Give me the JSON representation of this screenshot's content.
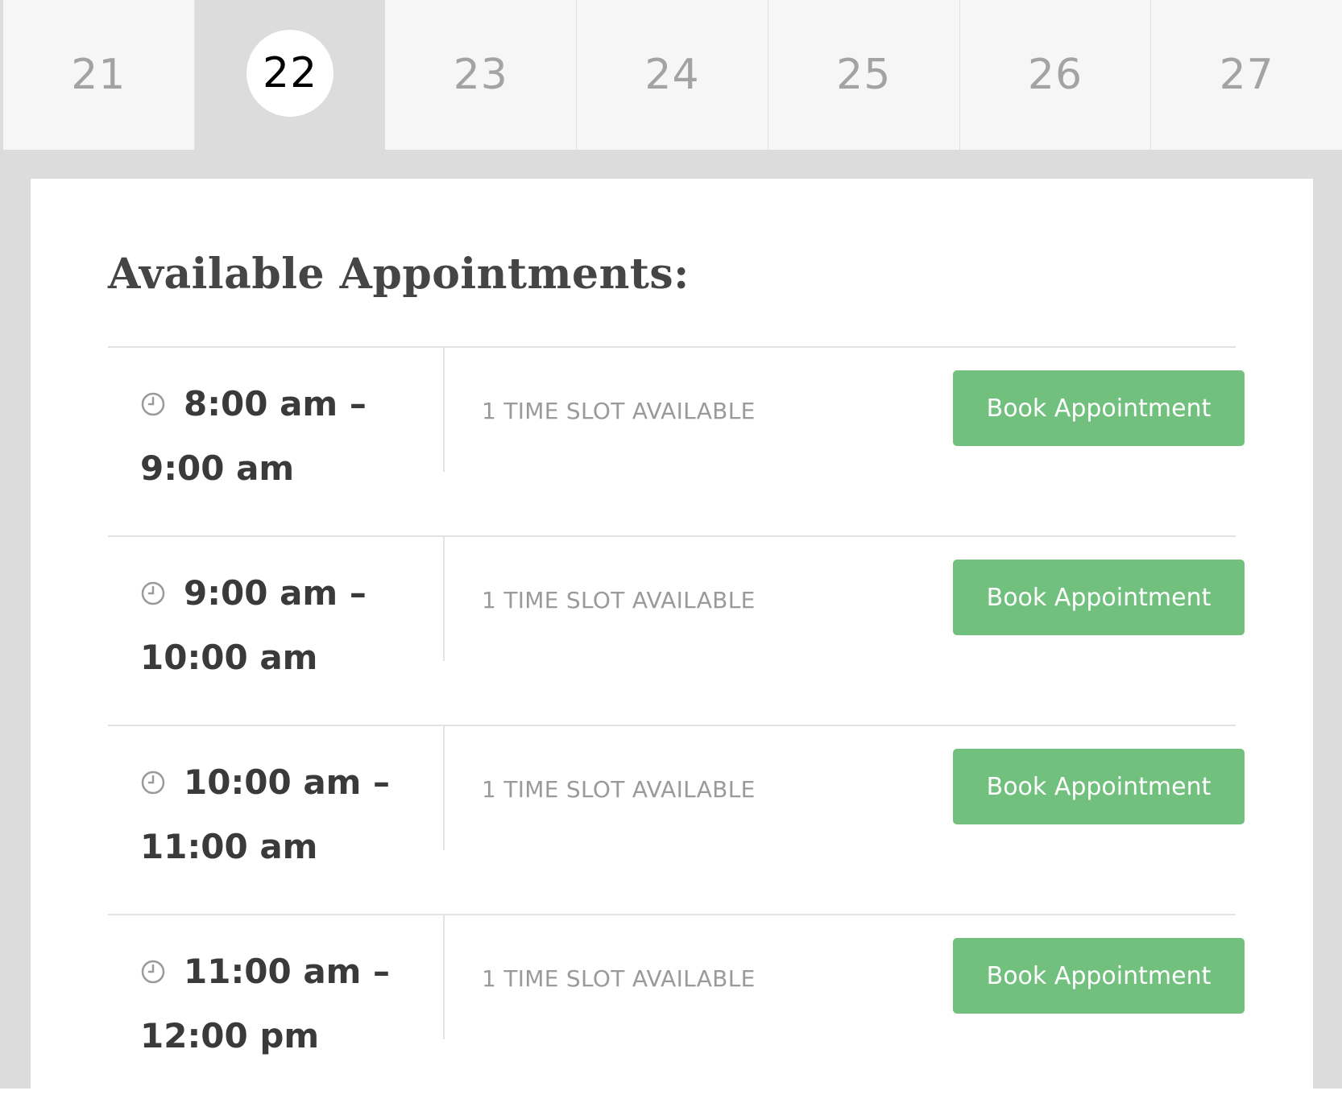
{
  "calendar": {
    "days": [
      {
        "label": "21",
        "selected": false
      },
      {
        "label": "22",
        "selected": true
      },
      {
        "label": "23",
        "selected": false
      },
      {
        "label": "24",
        "selected": false
      },
      {
        "label": "25",
        "selected": false
      },
      {
        "label": "26",
        "selected": false
      },
      {
        "label": "27",
        "selected": false
      }
    ]
  },
  "panel": {
    "title": "Available Appointments:"
  },
  "slots": [
    {
      "time": "8:00 am – 9:00 am",
      "availability": "1 TIME SLOT AVAILABLE",
      "button_label": "Book Appointment"
    },
    {
      "time": "9:00 am – 10:00 am",
      "availability": "1 TIME SLOT AVAILABLE",
      "button_label": "Book Appointment"
    },
    {
      "time": "10:00 am – 11:00 am",
      "availability": "1 TIME SLOT AVAILABLE",
      "button_label": "Book Appointment"
    },
    {
      "time": "11:00 am – 12:00 pm",
      "availability": "1 TIME SLOT AVAILABLE",
      "button_label": "Book Appointment"
    }
  ],
  "icons": {
    "slot_icon": "clock-icon"
  },
  "colors": {
    "button": "#72c07e",
    "selected_day_bg": "#dcdcdc",
    "selected_day_circle": "#ffffff"
  }
}
